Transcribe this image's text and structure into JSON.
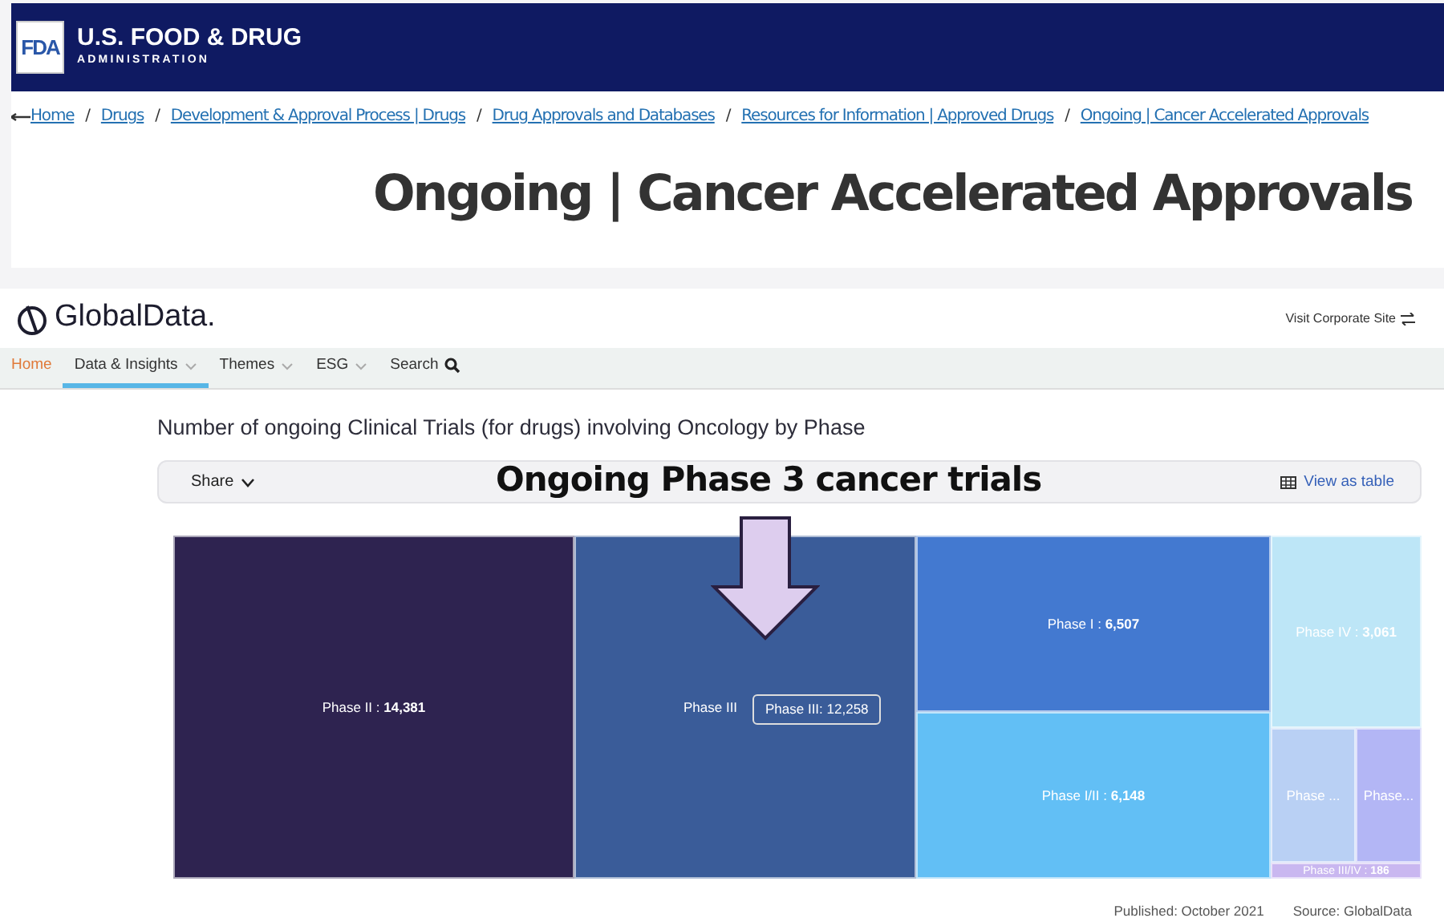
{
  "fda_header": {
    "logo": "FDA",
    "name": "U.S. FOOD & DRUG",
    "subtitle": "ADMINISTRATION"
  },
  "breadcrumbs": [
    {
      "label": "Home"
    },
    {
      "separator": "/",
      "label": "Drugs"
    },
    {
      "separator": "/",
      "label": "Development & Approval Process | Drugs"
    },
    {
      "separator": "/",
      "label": "Drug Approvals and Databases"
    },
    {
      "separator": "/",
      "label": "Resources for Information | Approved Drugs"
    },
    {
      "separator": "/",
      "label": "Ongoing | Cancer Accelerated Approvals"
    }
  ],
  "page_title": "Ongoing | Cancer Accelerated Approvals",
  "globaldata": {
    "logo": "GlobalData.",
    "corporate_link": "Visit Corporate Site",
    "nav": [
      {
        "label": "Home",
        "kind": "home",
        "selected": false
      },
      {
        "label": "Data & Insights",
        "kind": "menu",
        "selected": true
      },
      {
        "label": "Themes",
        "kind": "menu",
        "selected": false
      },
      {
        "label": "ESG",
        "kind": "menu",
        "selected": false
      },
      {
        "label": "Search",
        "kind": "search",
        "selected": false
      }
    ],
    "chart_title": "Number of ongoing Clinical Trials (for drugs) involving Oncology by Phase",
    "share": "Share",
    "view_table": "View as table",
    "annotation": "Ongoing Phase 3 cancer trials",
    "tiles": [
      {
        "label": "Phase II : **14,381**",
        "color": "#2e2350"
      },
      {
        "label": "Phase III",
        "color": "#3a5c99",
        "tooltip": "Phase III: 12,258"
      },
      {
        "label": "Phase I : **6,507**",
        "color": "#4379d0"
      },
      {
        "label": "Phase I/II : **6,148**",
        "color": "#62bff5"
      },
      {
        "label": "Phase IV : **3,061**",
        "color": "#bde6f7"
      },
      {
        "label": "Phase ...",
        "color": "#b9d0f4"
      },
      {
        "label": "Phase...",
        "color": "#b3b6f5"
      },
      {
        "label": "Phase III/IV : **186**",
        "color": "#c9b7f0"
      }
    ],
    "published": "Published: October 2021",
    "source": "Source: GlobalData"
  }
}
